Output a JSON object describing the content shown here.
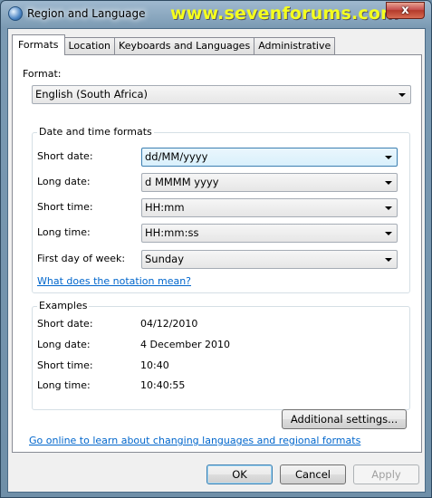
{
  "window": {
    "title": "Region and Language",
    "watermark": "www.sevenforums.com",
    "close_label": "x"
  },
  "tabs": [
    {
      "label": "Formats"
    },
    {
      "label": "Location"
    },
    {
      "label": "Keyboards and Languages"
    },
    {
      "label": "Administrative"
    }
  ],
  "format": {
    "label": "Format:",
    "value": "English (South Africa)"
  },
  "date_time": {
    "title": "Date and time formats",
    "short_date": {
      "label": "Short date:",
      "value": "dd/MM/yyyy"
    },
    "long_date": {
      "label": "Long date:",
      "value": "d MMMM yyyy"
    },
    "short_time": {
      "label": "Short time:",
      "value": "HH:mm"
    },
    "long_time": {
      "label": "Long time:",
      "value": "HH:mm:ss"
    },
    "first_day": {
      "label": "First day of week:",
      "value": "Sunday"
    },
    "notation_link": "What does the notation mean?"
  },
  "examples": {
    "title": "Examples",
    "rows": [
      {
        "label": "Short date:",
        "value": "04/12/2010"
      },
      {
        "label": "Long date:",
        "value": "4 December 2010"
      },
      {
        "label": "Short time:",
        "value": "10:40"
      },
      {
        "label": "Long time:",
        "value": "10:40:55"
      }
    ]
  },
  "additional_button": "Additional settings...",
  "online_link": "Go online to learn about changing languages and regional formats",
  "footer": {
    "ok": "OK",
    "cancel": "Cancel",
    "apply": "Apply"
  }
}
